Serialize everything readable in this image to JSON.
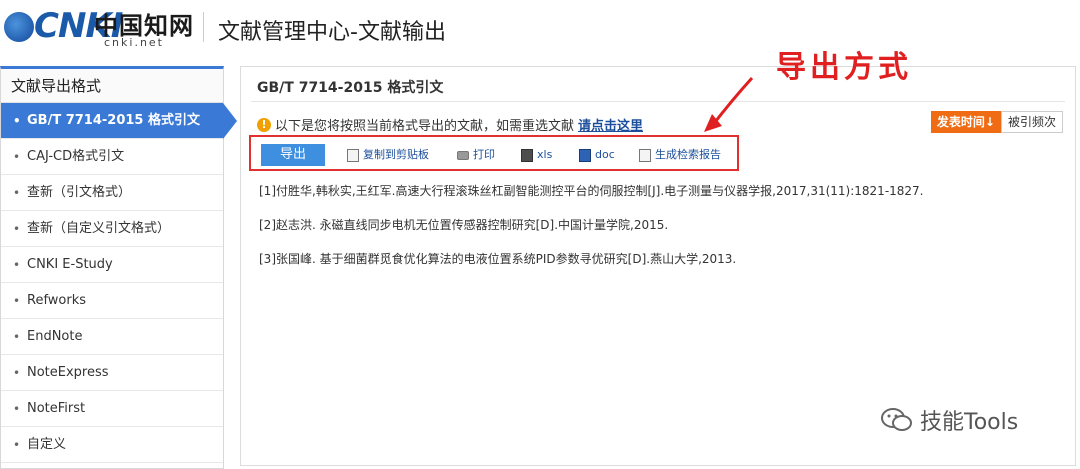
{
  "header": {
    "logo_mark": "CNKI",
    "logo_cn": "中国知网",
    "logo_url": "cnki.net",
    "title": "文献管理中心-文献输出"
  },
  "sidebar": {
    "title": "文献导出格式",
    "items": [
      {
        "label": "GB/T 7714-2015 格式引文",
        "active": true
      },
      {
        "label": "CAJ-CD格式引文"
      },
      {
        "label": "查新（引文格式）"
      },
      {
        "label": "查新（自定义引文格式）"
      },
      {
        "label": "CNKI E-Study"
      },
      {
        "label": "Refworks"
      },
      {
        "label": "EndNote"
      },
      {
        "label": "NoteExpress"
      },
      {
        "label": "NoteFirst"
      },
      {
        "label": "自定义"
      }
    ]
  },
  "main": {
    "title": "GB/T 7714-2015 格式引文",
    "notice_text": "以下是您将按照当前格式导出的文献，如需重选文献",
    "notice_link": "请点击这里",
    "warn_icon": "!",
    "top_buttons": {
      "orange": "发表时间↓",
      "plain": "被引频次"
    },
    "toolbar": {
      "export": "导出",
      "copy": "复制到剪贴板",
      "print": "打印",
      "xls": "xls",
      "doc": "doc",
      "report": "生成检索报告"
    },
    "references": [
      "[1]付胜华,韩秋实,王红军.高速大行程滚珠丝杠副智能测控平台的伺服控制[J].电子测量与仪器学报,2017,31(11):1821-1827.",
      "[2]赵志洪. 永磁直线同步电机无位置传感器控制研究[D].中国计量学院,2015.",
      "[3]张国峰. 基于细菌群觅食优化算法的电液位置系统PID参数寻优研究[D].燕山大学,2013."
    ]
  },
  "annotation": {
    "label": "导出方式",
    "color": "#e02020"
  },
  "watermark": {
    "text": "技能Tools"
  },
  "colors": {
    "accent": "#3a7ad6",
    "export_button": "#3e8fe0",
    "sort_button": "#ef6c14",
    "link": "#1b4e9b"
  }
}
